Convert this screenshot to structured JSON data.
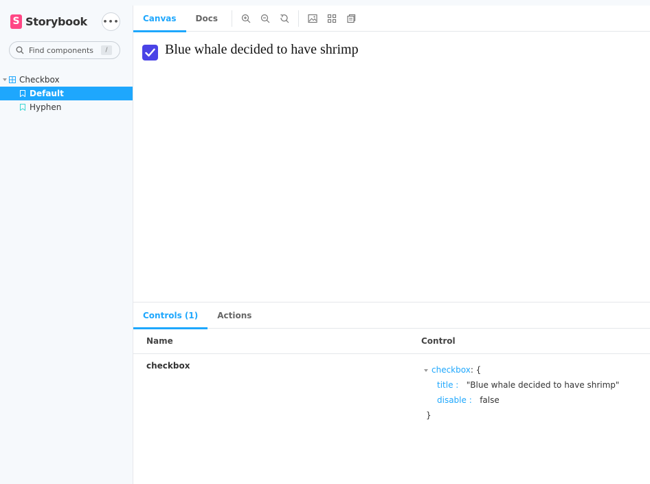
{
  "sidebar": {
    "brand": "Storybook",
    "logo_letter": "S",
    "menu_label": "•••",
    "search_placeholder": "Find components",
    "search_shortcut": "/",
    "tree": {
      "component_label": "Checkbox",
      "stories": [
        {
          "label": "Default",
          "selected": true
        },
        {
          "label": "Hyphen",
          "selected": false
        }
      ]
    }
  },
  "toolbar": {
    "tabs": [
      {
        "label": "Canvas",
        "active": true
      },
      {
        "label": "Docs",
        "active": false
      }
    ],
    "tools": [
      "zoom-in-icon",
      "zoom-out-icon",
      "zoom-reset-icon",
      "background-icon",
      "grid-icon",
      "viewport-icon"
    ]
  },
  "canvas": {
    "checkbox_checked": true,
    "label": "Blue whale decided to have shrimp"
  },
  "panel": {
    "tabs": [
      {
        "label": "Controls (1)",
        "active": true
      },
      {
        "label": "Actions",
        "active": false
      }
    ],
    "columns": {
      "name": "Name",
      "control": "Control"
    },
    "rows": [
      {
        "name": "checkbox",
        "control": {
          "key": "checkbox",
          "open_brace": ": {",
          "fields": [
            {
              "key": "title :",
              "value": "\"Blue whale decided to have shrimp\""
            },
            {
              "key": "disable :",
              "value": "false"
            }
          ],
          "close_brace": "}"
        }
      }
    ]
  },
  "colors": {
    "accent": "#1ea7fd",
    "brand": "#ff4785",
    "checkbox": "#4a43e6"
  }
}
